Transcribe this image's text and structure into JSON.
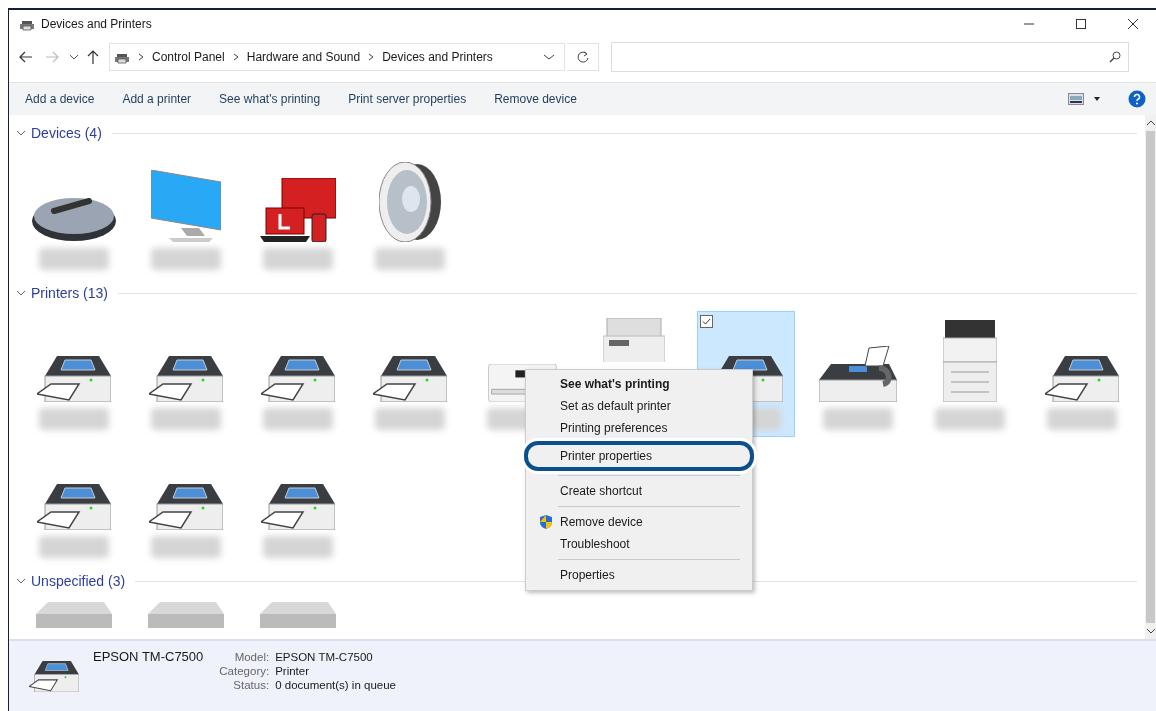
{
  "window": {
    "title": "Devices and Printers"
  },
  "address_bar": {
    "crumbs": [
      "Control Panel",
      "Hardware and Sound",
      "Devices and Printers"
    ]
  },
  "toolbar": {
    "buttons": [
      "Add a device",
      "Add a printer",
      "See what's printing",
      "Print server properties",
      "Remove device"
    ]
  },
  "groups": [
    {
      "title": "Devices (4)",
      "expanded": true,
      "items": [
        {
          "kind": "mouse",
          "selected": false
        },
        {
          "kind": "monitor",
          "selected": false
        },
        {
          "kind": "multidevice",
          "selected": false
        },
        {
          "kind": "speaker",
          "selected": false
        }
      ]
    },
    {
      "title": "Printers (13)",
      "expanded": true,
      "items": [
        {
          "kind": "printer",
          "selected": false
        },
        {
          "kind": "printer",
          "selected": false
        },
        {
          "kind": "printer",
          "selected": false
        },
        {
          "kind": "printer",
          "selected": false
        },
        {
          "kind": "inkjet",
          "selected": false
        },
        {
          "kind": "copier",
          "selected": false
        },
        {
          "kind": "printer",
          "selected": true
        },
        {
          "kind": "fax",
          "selected": false
        },
        {
          "kind": "mfp",
          "selected": false
        },
        {
          "kind": "printer",
          "selected": false
        },
        {
          "kind": "printer",
          "selected": false
        },
        {
          "kind": "printer",
          "selected": false
        },
        {
          "kind": "printer",
          "selected": false
        }
      ]
    },
    {
      "title": "Unspecified (3)",
      "expanded": true,
      "items": [
        {
          "kind": "box",
          "selected": false
        },
        {
          "kind": "box",
          "selected": false
        },
        {
          "kind": "box",
          "selected": false
        }
      ]
    }
  ],
  "context_menu": {
    "items": [
      {
        "kind": "item",
        "label": "See what's printing",
        "default": true,
        "circled": false
      },
      {
        "kind": "item",
        "label": "Set as default printer",
        "default": false,
        "circled": false
      },
      {
        "kind": "item",
        "label": "Printing preferences",
        "default": false,
        "circled": false
      },
      {
        "kind": "item",
        "label": "Printer properties",
        "default": false,
        "circled": true
      },
      {
        "kind": "separator"
      },
      {
        "kind": "item",
        "label": "Create shortcut",
        "default": false,
        "circled": false
      },
      {
        "kind": "separator"
      },
      {
        "kind": "admin",
        "label": "Remove device",
        "default": false,
        "circled": false
      },
      {
        "kind": "item",
        "label": "Troubleshoot",
        "default": false,
        "circled": false
      },
      {
        "kind": "separator"
      },
      {
        "kind": "item",
        "label": "Properties",
        "default": false,
        "circled": false
      }
    ]
  },
  "details": {
    "name": "EPSON TM-C7500",
    "fields": [
      {
        "label": "Model:",
        "value": "EPSON TM-C7500"
      },
      {
        "label": "Category:",
        "value": "Printer"
      },
      {
        "label": "Status:",
        "value": "0 document(s) in queue"
      }
    ]
  }
}
